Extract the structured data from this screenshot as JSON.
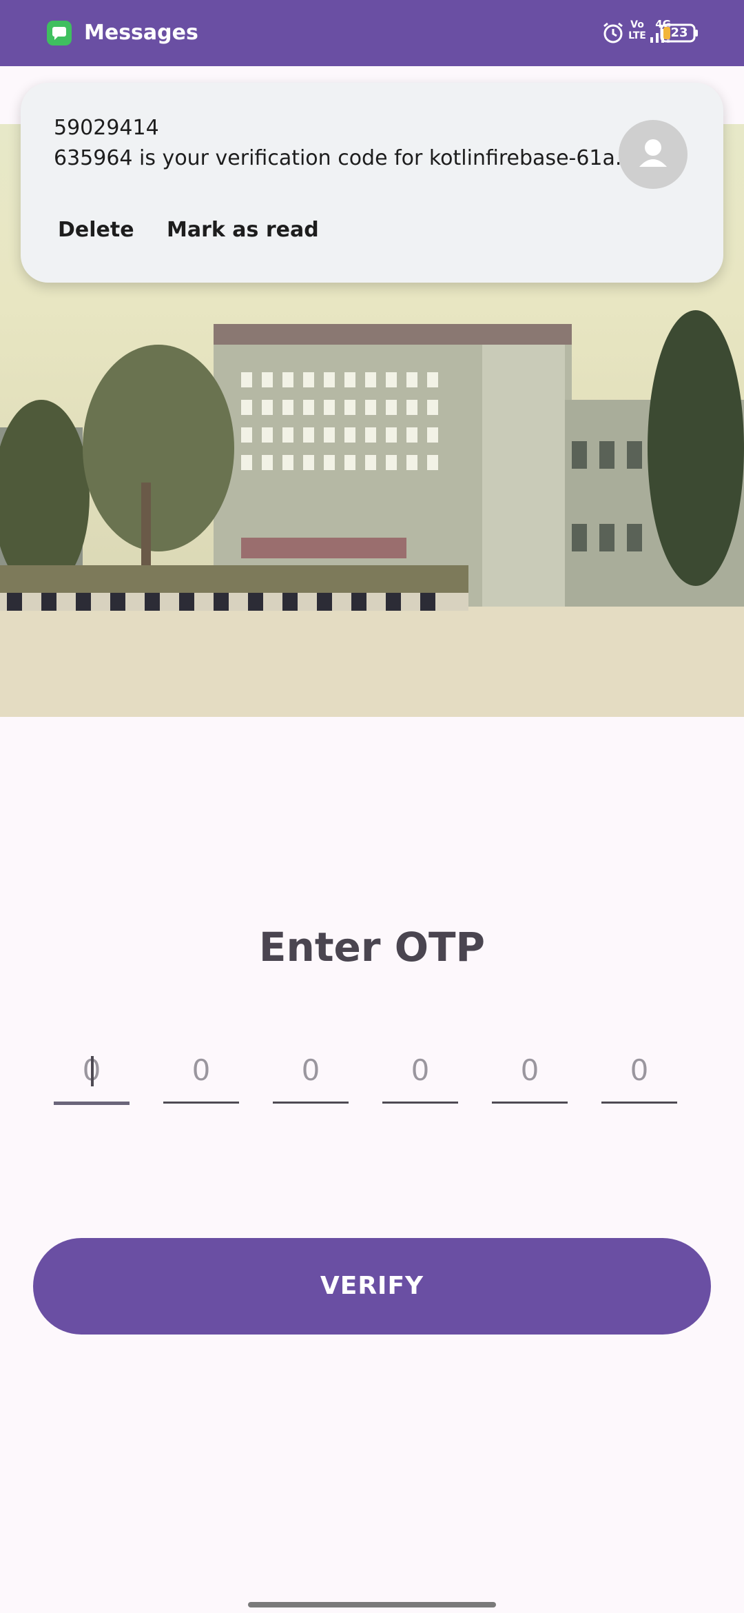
{
  "status_bar": {
    "app_name": "Messages",
    "volte": "Vo LTE",
    "network": "4G",
    "battery": "23",
    "background_color": "#6a4fa3"
  },
  "notification": {
    "sender": "59029414",
    "message": "635964 is your verification code for kotlinfirebase-61a..",
    "actions": {
      "delete": "Delete",
      "mark_read": "Mark as read"
    }
  },
  "otp": {
    "title": "Enter OTP",
    "fields": [
      {
        "placeholder": "0"
      },
      {
        "placeholder": "0"
      },
      {
        "placeholder": "0"
      },
      {
        "placeholder": "0"
      },
      {
        "placeholder": "0"
      },
      {
        "placeholder": "0"
      }
    ]
  },
  "verify_label": "VERIFY",
  "colors": {
    "accent": "#6a4fa3",
    "background": "#fdf8fc"
  }
}
